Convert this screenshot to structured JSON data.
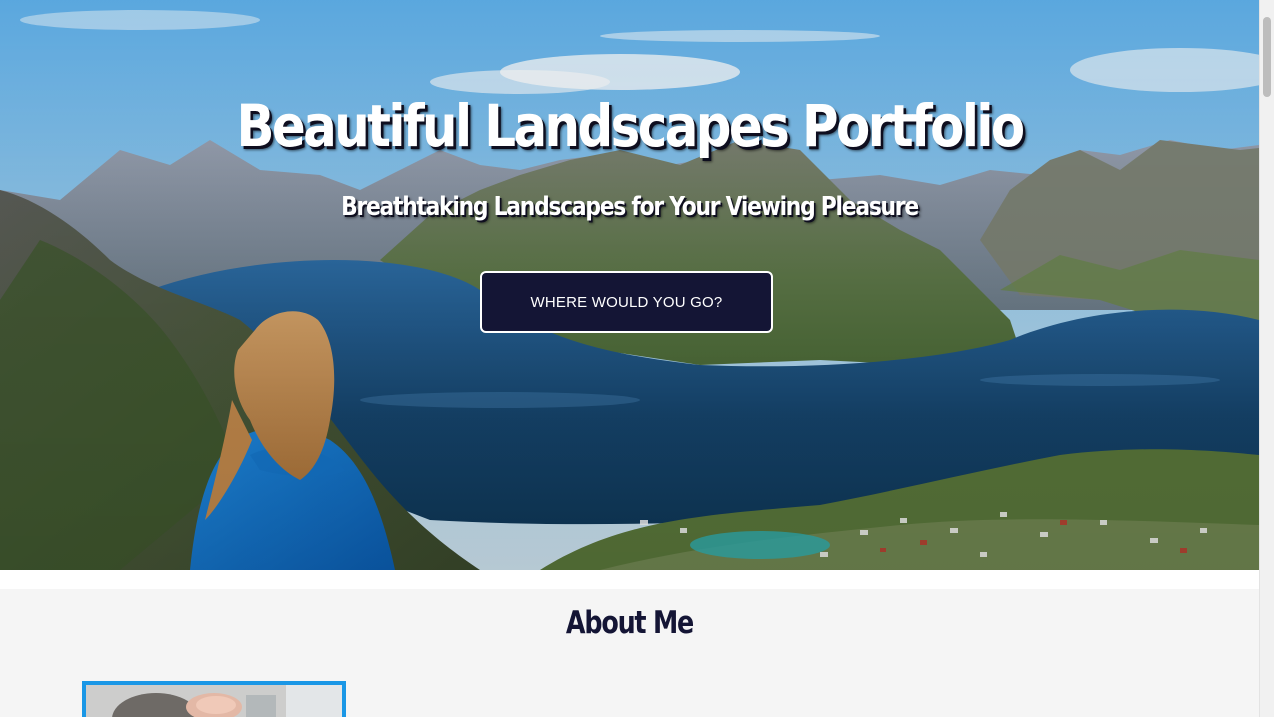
{
  "hero": {
    "title": "Beautiful Landscapes Portfolio",
    "subtitle": "Breathtaking Landscapes for Your Viewing Pleasure",
    "cta_label": "WHERE WOULD YOU GO?",
    "background_image": "mountain-fjord-landscape-with-woman-in-blue-hoodie"
  },
  "about": {
    "title": "About Me",
    "profile_image": "profile-photo"
  },
  "colors": {
    "navy": "#141535",
    "accent_blue": "#1a97e6",
    "section_bg": "#f5f5f5"
  }
}
